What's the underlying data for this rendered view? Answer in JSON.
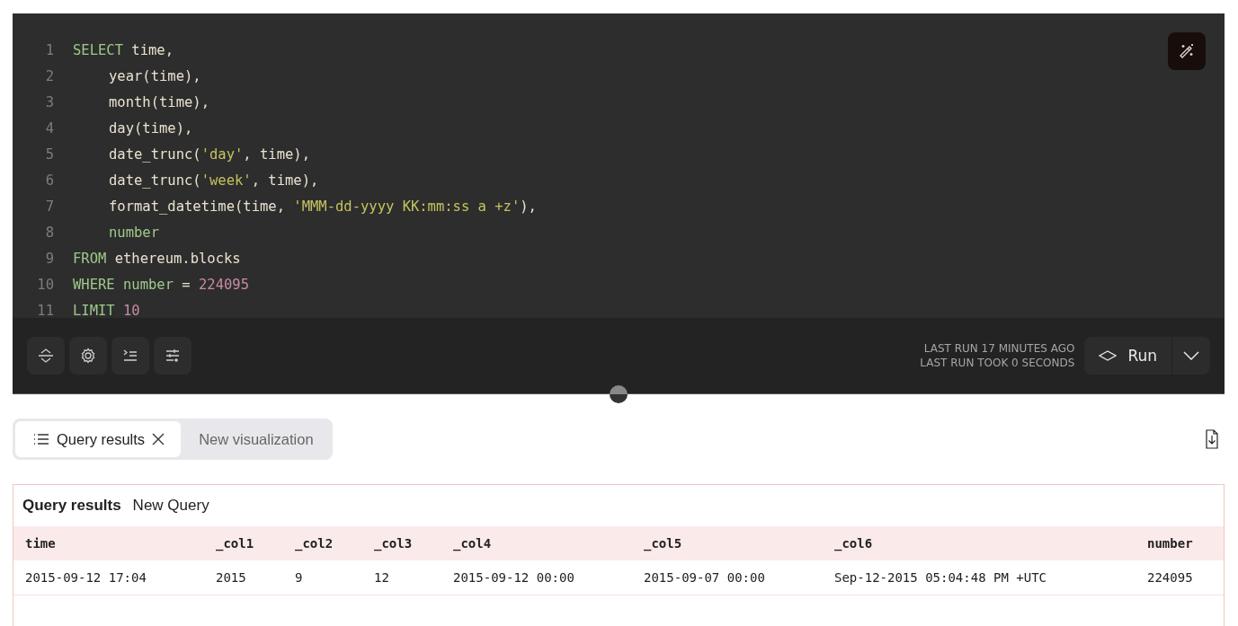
{
  "editor": {
    "lines": [
      {
        "number": "1",
        "indent": false,
        "tokens": [
          {
            "kind": "keyword",
            "text": "SELECT"
          },
          {
            "kind": "plain",
            "text": " time,"
          }
        ]
      },
      {
        "number": "2",
        "indent": true,
        "tokens": [
          {
            "kind": "plain",
            "text": "year(time),"
          }
        ]
      },
      {
        "number": "3",
        "indent": true,
        "tokens": [
          {
            "kind": "plain",
            "text": "month(time),"
          }
        ]
      },
      {
        "number": "4",
        "indent": true,
        "tokens": [
          {
            "kind": "plain",
            "text": "day(time),"
          }
        ]
      },
      {
        "number": "5",
        "indent": true,
        "tokens": [
          {
            "kind": "plain",
            "text": "date_trunc("
          },
          {
            "kind": "string",
            "text": "'day'"
          },
          {
            "kind": "plain",
            "text": ", time),"
          }
        ]
      },
      {
        "number": "6",
        "indent": true,
        "tokens": [
          {
            "kind": "plain",
            "text": "date_trunc("
          },
          {
            "kind": "string",
            "text": "'week'"
          },
          {
            "kind": "plain",
            "text": ", time),"
          }
        ]
      },
      {
        "number": "7",
        "indent": true,
        "tokens": [
          {
            "kind": "plain",
            "text": "format_datetime(time, "
          },
          {
            "kind": "string",
            "text": "'MMM-dd-yyyy KK:mm:ss a +z'"
          },
          {
            "kind": "plain",
            "text": "),"
          }
        ]
      },
      {
        "number": "8",
        "indent": true,
        "tokens": [
          {
            "kind": "keyword",
            "text": "number"
          }
        ]
      },
      {
        "number": "9",
        "indent": false,
        "tokens": [
          {
            "kind": "keyword",
            "text": "FROM"
          },
          {
            "kind": "plain",
            "text": " ethereum.blocks"
          }
        ]
      },
      {
        "number": "10",
        "indent": false,
        "tokens": [
          {
            "kind": "keyword",
            "text": "WHERE number"
          },
          {
            "kind": "plain",
            "text": " = "
          },
          {
            "kind": "number",
            "text": "224095"
          }
        ]
      },
      {
        "number": "11",
        "indent": false,
        "tokens": [
          {
            "kind": "keyword",
            "text": "LIMIT"
          },
          {
            "kind": "number",
            "text": " 10"
          }
        ]
      }
    ],
    "last_run": "LAST RUN 17 MINUTES AGO",
    "last_run_took": "LAST RUN TOOK 0 SECONDS",
    "run_button": "Run"
  },
  "tabs": [
    {
      "label": "Query results",
      "selected": true
    },
    {
      "label": "New visualization",
      "selected": false
    }
  ],
  "results": {
    "title": "Query results",
    "query_name": "New Query",
    "columns": [
      "time",
      "_col1",
      "_col2",
      "_col3",
      "_col4",
      "_col5",
      "_col6",
      "number"
    ],
    "rows": [
      [
        "2015-09-12 17:04",
        "2015",
        "9",
        "12",
        "2015-09-12 00:00",
        "2015-09-07 00:00",
        "Sep-12-2015 05:04:48 PM +UTC",
        "224095"
      ]
    ]
  }
}
